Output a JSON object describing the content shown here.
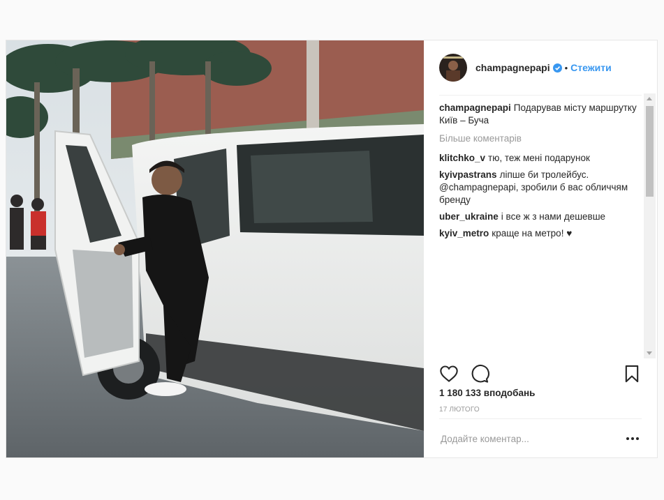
{
  "post": {
    "author": {
      "username": "champagnepapi",
      "verified": true,
      "follow_label": "Стежити",
      "dot": "•"
    },
    "caption": {
      "username": "champagnepapi",
      "text": "Подарував місту маршрутку Київ – Буча"
    },
    "more_comments_label": "Більше коментарів",
    "comments": [
      {
        "username": "klitchko_v",
        "text": "тю, теж мені подарунок"
      },
      {
        "username": "kyivpastrans",
        "text": "ліпше би тролейбус. @champagnepapi, зробили б вас обличчям бренду"
      },
      {
        "username": "uber_ukraine",
        "text": "і все ж з нами дешевше"
      },
      {
        "username": "kyiv_metro",
        "text": "краще на метро! ♥"
      }
    ],
    "likes": "1 180 133 вподобань",
    "date": "17 лютого",
    "add_comment_placeholder": "Додайте коментар..."
  },
  "icons": {
    "verified": "verified-badge-icon",
    "like": "heart-icon",
    "comment": "comment-bubble-icon",
    "save": "bookmark-icon",
    "options": "more-options-icon"
  },
  "colors": {
    "accent": "#3897f0",
    "text": "#262626",
    "muted": "#999999",
    "border": "#efefef"
  }
}
